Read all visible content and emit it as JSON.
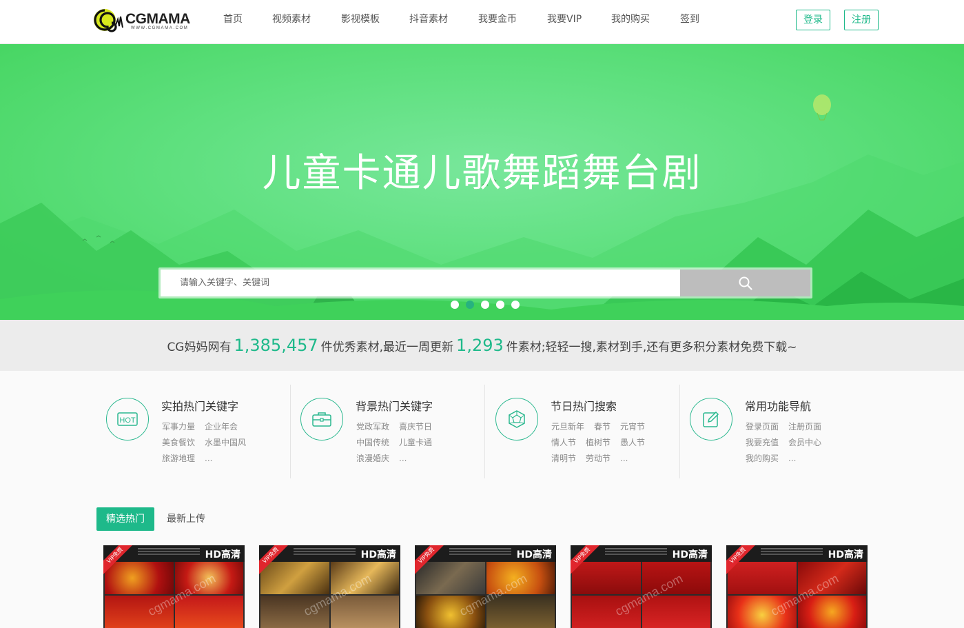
{
  "header": {
    "logo_text": "CGMAMA",
    "logo_sub": "WWW.CGMAMA.COM",
    "nav": [
      "首页",
      "视频素材",
      "影视模板",
      "抖音素材",
      "我要金币",
      "我要VIP",
      "我的购买",
      "签到"
    ],
    "login": "登录",
    "register": "注册"
  },
  "banner": {
    "title": "儿童卡通儿歌舞蹈舞台剧",
    "search_placeholder": "请输入关键字、关键词",
    "slides": 5,
    "active_slide": 2
  },
  "stats": {
    "prefix": "CG妈妈网有",
    "total": "1,385,457",
    "middle": "件优秀素材,最近一周更新",
    "weekly": "1,293",
    "suffix": "件素材;轻轻一搜,素材到手,还有更多积分素材免费下载~"
  },
  "categories": [
    {
      "title": "实拍热门关键字",
      "icon": "hot-icon",
      "links": [
        "军事力量",
        "企业年会",
        "美食餐饮",
        "水墨中国风",
        "旅游地理",
        "..."
      ]
    },
    {
      "title": "背景热门关键字",
      "icon": "briefcase-icon",
      "links": [
        "党政军政",
        "喜庆节日",
        "中国传统",
        "儿童卡通",
        "浪漫婚庆",
        "..."
      ]
    },
    {
      "title": "节日热门搜索",
      "icon": "gem-icon",
      "links": [
        "元旦新年",
        "春节",
        "元宵节",
        "情人节",
        "植树节",
        "愚人节",
        "清明节",
        "劳动节",
        "..."
      ]
    },
    {
      "title": "常用功能导航",
      "icon": "edit-icon",
      "links": [
        "登录页面",
        "注册页面",
        "我要充值",
        "会员中心",
        "我的购买",
        "..."
      ]
    }
  ],
  "tabs": [
    "精选热门",
    "最新上传"
  ],
  "thumbs": [
    {
      "badge": "HD高清",
      "vip": "VIP免费",
      "watermark": "cgmama.com"
    },
    {
      "badge": "HD高清",
      "vip": "VIP免费",
      "watermark": "cgmama.com"
    },
    {
      "badge": "HD高清",
      "vip": "VIP免费",
      "watermark": "cgmama.com"
    },
    {
      "badge": "HD高清",
      "vip": "VIP免费",
      "watermark": "cgmama.com"
    },
    {
      "badge": "HD高清",
      "vip": "VIP免费",
      "watermark": "cgmama.com"
    }
  ],
  "colors": {
    "accent": "#1eb98a",
    "banner": "#5fe07f",
    "vip": "#e0262d"
  }
}
